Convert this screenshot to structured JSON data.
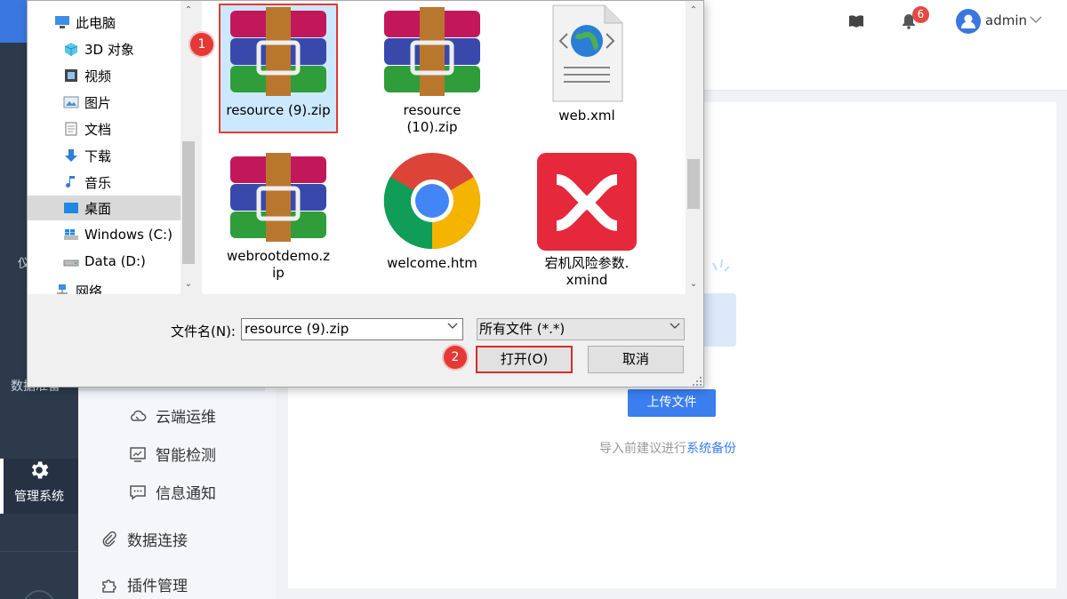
{
  "left_rail": {
    "item_partial_1": "仪",
    "item_partial_2": "数据准备",
    "manage_system": "管理系统"
  },
  "submenu": {
    "items": [
      {
        "label": "云端运维",
        "icon": "cloud-wrench-icon"
      },
      {
        "label": "智能检测",
        "icon": "monitor-chart-icon"
      },
      {
        "label": "信息通知",
        "icon": "message-dots-icon"
      },
      {
        "label": "数据连接",
        "icon": "paperclip-icon"
      },
      {
        "label": "插件管理",
        "icon": "puzzle-icon"
      }
    ]
  },
  "header": {
    "notification_count": "6",
    "username": "admin"
  },
  "content": {
    "upload_button": "上传文件",
    "hint_prefix": "导入前建议进行",
    "hint_link": "系统备份"
  },
  "dialog": {
    "tree": [
      {
        "label": "此电脑",
        "icon": "computer-icon"
      },
      {
        "label": "3D 对象",
        "icon": "cube-3d-icon"
      },
      {
        "label": "视频",
        "icon": "film-icon"
      },
      {
        "label": "图片",
        "icon": "picture-icon"
      },
      {
        "label": "文档",
        "icon": "document-icon"
      },
      {
        "label": "下载",
        "icon": "download-arrow-icon"
      },
      {
        "label": "音乐",
        "icon": "music-note-icon"
      },
      {
        "label": "桌面",
        "icon": "desktop-icon"
      },
      {
        "label": "Windows (C:)",
        "icon": "windows-drive-icon"
      },
      {
        "label": "Data (D:)",
        "icon": "drive-icon"
      },
      {
        "label": "网络",
        "icon": "network-icon"
      }
    ],
    "files": [
      {
        "line1": "resource (9).zip",
        "line2": "",
        "icon": "winrar-archive-icon"
      },
      {
        "line1": "resource",
        "line2": "(10).zip",
        "icon": "winrar-archive-icon"
      },
      {
        "line1": "web.xml",
        "line2": "",
        "icon": "xml-globe-icon"
      },
      {
        "line1": "webrootdemo.z",
        "line2": "ip",
        "icon": "winrar-archive-icon"
      },
      {
        "line1": "welcome.htm",
        "line2": "",
        "icon": "chrome-icon"
      },
      {
        "line1": "宕机风险参数.",
        "line2": "xmind",
        "icon": "xmind-icon"
      }
    ],
    "filename_label": "文件名(N):",
    "filename_value": "resource (9).zip",
    "filetype_value": "所有文件 (*.*)",
    "open_button": "打开(O)",
    "cancel_button": "取消"
  },
  "steps": [
    "1",
    "2"
  ],
  "colors": {
    "accent_blue": "#3a7ef0",
    "highlight_red": "#e53935",
    "rail_dark": "#2d3a4b"
  }
}
